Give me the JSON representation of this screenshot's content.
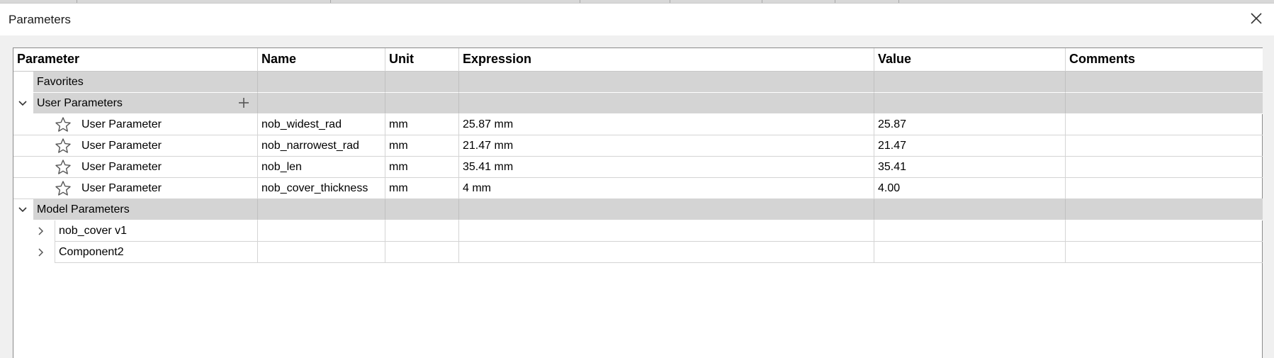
{
  "window": {
    "title": "Parameters"
  },
  "table": {
    "columns": [
      "Parameter",
      "Name",
      "Unit",
      "Expression",
      "Value",
      "Comments"
    ],
    "groups": {
      "favorites": {
        "label": "Favorites"
      },
      "user": {
        "label": "User Parameters",
        "expanded": true
      },
      "model": {
        "label": "Model Parameters",
        "expanded": true
      }
    },
    "user_rows": [
      {
        "parameter": "User Parameter",
        "name": "nob_widest_rad",
        "unit": "mm",
        "expression": "25.87 mm",
        "value": "25.87",
        "comment": ""
      },
      {
        "parameter": "User Parameter",
        "name": "nob_narrowest_rad",
        "unit": "mm",
        "expression": "21.47 mm",
        "value": "21.47",
        "comment": ""
      },
      {
        "parameter": "User Parameter",
        "name": "nob_len",
        "unit": "mm",
        "expression": "35.41 mm",
        "value": "35.41",
        "comment": ""
      },
      {
        "parameter": "User Parameter",
        "name": "nob_cover_thickness",
        "unit": "mm",
        "expression": "4 mm",
        "value": "4.00",
        "comment": ""
      }
    ],
    "model_rows": [
      {
        "parameter": "nob_cover v1",
        "expanded": false
      },
      {
        "parameter": "Component2",
        "expanded": false
      }
    ]
  },
  "icons": {
    "close": "close-icon",
    "expand": "chevron-down-icon",
    "collapsed": "chevron-right-icon",
    "favorite": "star-icon",
    "add": "plus-icon"
  },
  "colors": {
    "group_bg": "#d4d4d4",
    "window_bg": "#f0f0f0",
    "grid_bg": "#ffffff"
  }
}
